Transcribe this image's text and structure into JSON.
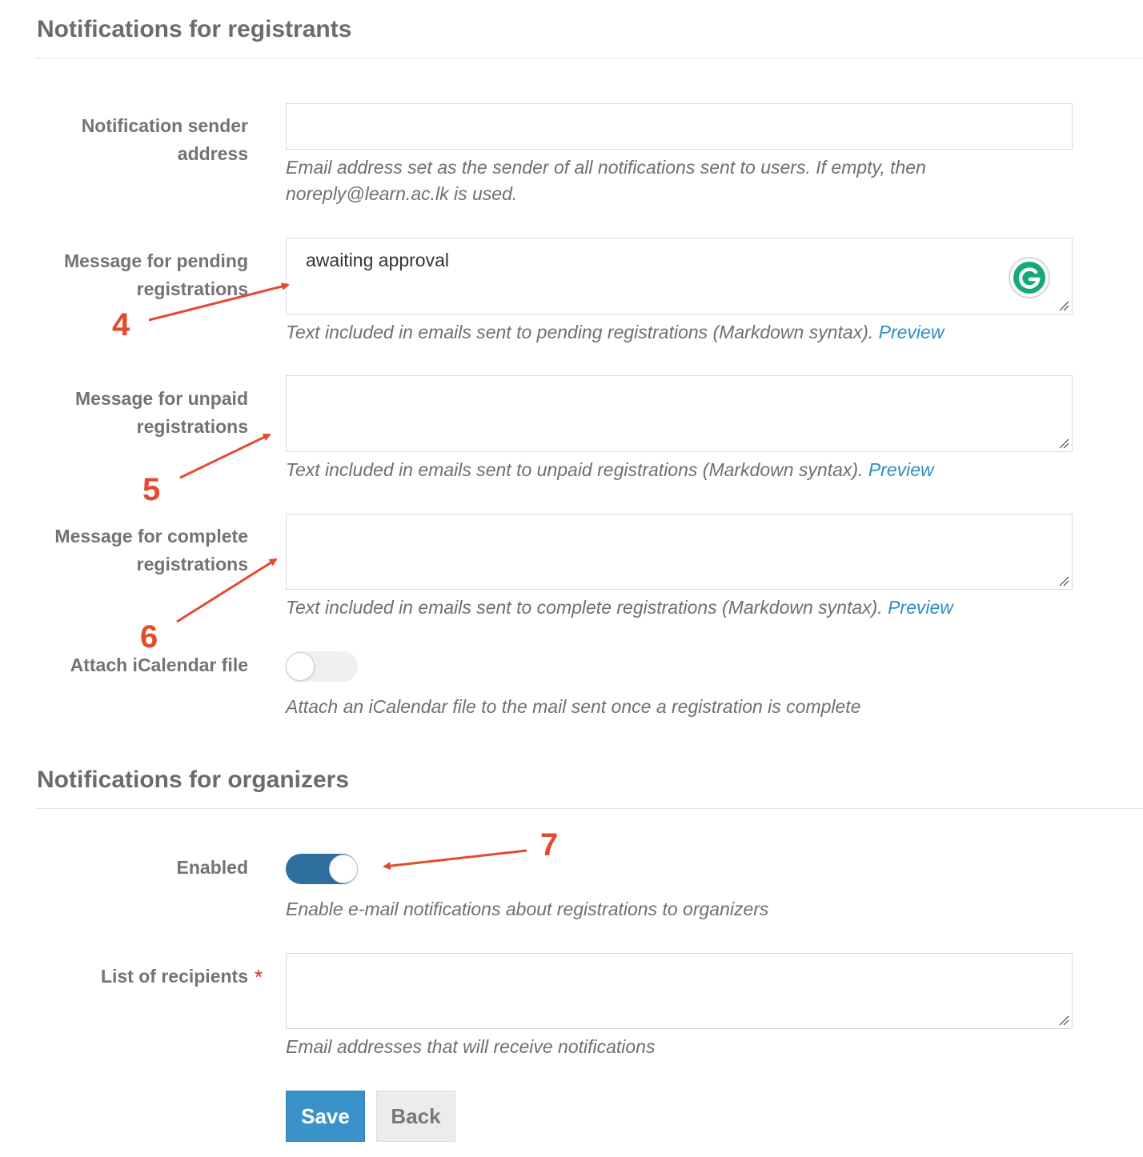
{
  "registrants": {
    "title": "Notifications for registrants",
    "sender": {
      "label_line1": "Notification sender",
      "label_line2": "address",
      "value": "",
      "help_line1": "Email address set as the sender of all notifications sent to users. If empty, then",
      "help_line2": "noreply@learn.ac.lk is used."
    },
    "pending": {
      "label_line1": "Message for pending",
      "label_line2": "registrations",
      "value": "awaiting approval",
      "help": "Text included in emails sent to pending registrations (Markdown syntax).",
      "link": "Preview"
    },
    "unpaid": {
      "label_line1": "Message for unpaid",
      "label_line2": "registrations",
      "value": "",
      "help": "Text included in emails sent to unpaid registrations (Markdown syntax).",
      "link": "Preview"
    },
    "complete": {
      "label_line1": "Message for complete",
      "label_line2": "registrations",
      "value": "",
      "help": "Text included in emails sent to complete registrations (Markdown syntax).",
      "link": "Preview"
    },
    "icalendar": {
      "label": "Attach iCalendar file",
      "enabled": false,
      "help": "Attach an iCalendar file to the mail sent once a registration is complete"
    }
  },
  "organizers": {
    "title": "Notifications for organizers",
    "enabled": {
      "label": "Enabled",
      "enabled": true,
      "help": "Enable e-mail notifications about registrations to organizers"
    },
    "recipients": {
      "label": "List of recipients",
      "required_mark": "*",
      "value": "",
      "help": "Email addresses that will receive notifications"
    }
  },
  "actions": {
    "save": "Save",
    "back": "Back"
  },
  "annotations": [
    "4",
    "5",
    "6",
    "7"
  ],
  "colors": {
    "accent": "#3a93c8",
    "annotation": "#e34a2e",
    "toggle_on": "#2e6f9f"
  }
}
